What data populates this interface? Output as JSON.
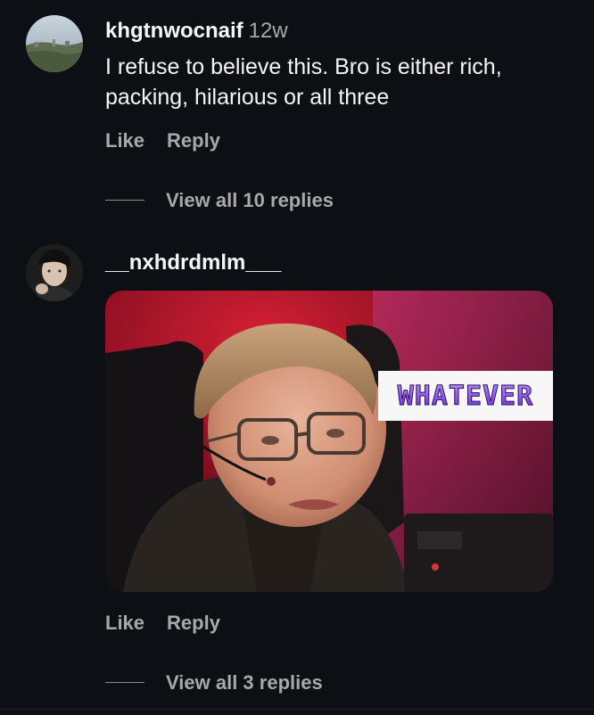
{
  "comments": [
    {
      "username": "khgtnwocnaif",
      "time": "12w",
      "text": "I refuse to believe this. Bro is either rich, packing, hilarious or all three",
      "like_label": "Like",
      "reply_label": "Reply",
      "view_replies": "View all 10 replies"
    },
    {
      "username": "__nxhdrdmlm___",
      "gif_caption": "WHATEVER",
      "like_label": "Like",
      "reply_label": "Reply",
      "view_replies": "View all 3 replies"
    }
  ],
  "colors": {
    "background": "#0c1014",
    "primary_text": "#f5f5f5",
    "secondary_text": "#a8a8a8"
  }
}
